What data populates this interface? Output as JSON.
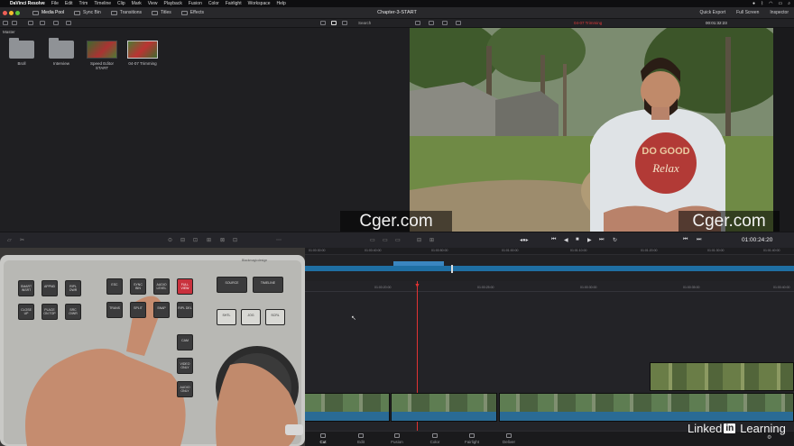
{
  "menubar": {
    "apple": "",
    "app": "DaVinci Resolve",
    "items": [
      "File",
      "Edit",
      "Trim",
      "Timeline",
      "Clip",
      "Mark",
      "View",
      "Playback",
      "Fusion",
      "Color",
      "Fairlight",
      "Workspace",
      "Help"
    ]
  },
  "toolbar": {
    "media_pool": "Media Pool",
    "sync_bin": "Sync Bin",
    "transitions": "Transitions",
    "titles": "Titles",
    "effects": "Effects",
    "project_title": "Chapter-3-START",
    "quick_export": "Quick Export",
    "full_screen": "Full Screen",
    "inspector": "Inspector"
  },
  "subbar": {
    "search": "Search",
    "clip_name": "04-07 Trimming",
    "timecode": "00:01:32:23"
  },
  "media_pool": {
    "master": "Master",
    "bins": [
      {
        "label": "Broll",
        "type": "folder"
      },
      {
        "label": "Interview",
        "type": "folder"
      },
      {
        "label": "Speed Editor START",
        "type": "timeline"
      },
      {
        "label": "04-07 Trimming",
        "type": "timeline"
      }
    ]
  },
  "viewer": {
    "shirt_line1": "DO GOOD",
    "shirt_line2": "Relax"
  },
  "watermarks": [
    "Cger.com",
    "Cger.com"
  ],
  "transport": {
    "timecode": "01:00:24:20"
  },
  "ruler_top": [
    "01:00:00:00",
    "01:00:10:00",
    "01:00:20:00",
    "01:00:30:00",
    "01:00:40:00",
    "01:00:50:00",
    "01:01:00:00",
    "01:01:10:00",
    "01:01:20:00",
    "01:01:30:00",
    "01:01:40:00"
  ],
  "ruler_lower": [
    "01:00:20:00",
    "01:00:25:00",
    "01:00:30:00",
    "01:00:35:00",
    "01:00:40:00"
  ],
  "pages": [
    "Cut",
    "Edit",
    "Fusion",
    "Color",
    "Fairlight",
    "Deliver"
  ],
  "active_page": "Cut",
  "linkedin": {
    "left": "Linked",
    "in": "in",
    "right": "Learning"
  },
  "speed_editor": {
    "brand": "Blackmagicdesign",
    "keys_left": [
      "SMART INSRT",
      "APPND",
      "RIPL OWR",
      "CLOSE UP",
      "PLACE ON TOP",
      "SRC O/WR"
    ],
    "keys_mid": [
      "ESC",
      "SYNC BIN",
      "AUDIO LEVEL",
      "FULL VIEW",
      "TRANS",
      "SPLIT",
      "SNAP",
      "RIPL DEL",
      "CAM",
      "VIDEO ONLY",
      "AUDIO ONLY"
    ],
    "keys_right": [
      "SOURCE",
      "TIMELINE",
      "SHTL",
      "JOG",
      "SCRL"
    ]
  }
}
